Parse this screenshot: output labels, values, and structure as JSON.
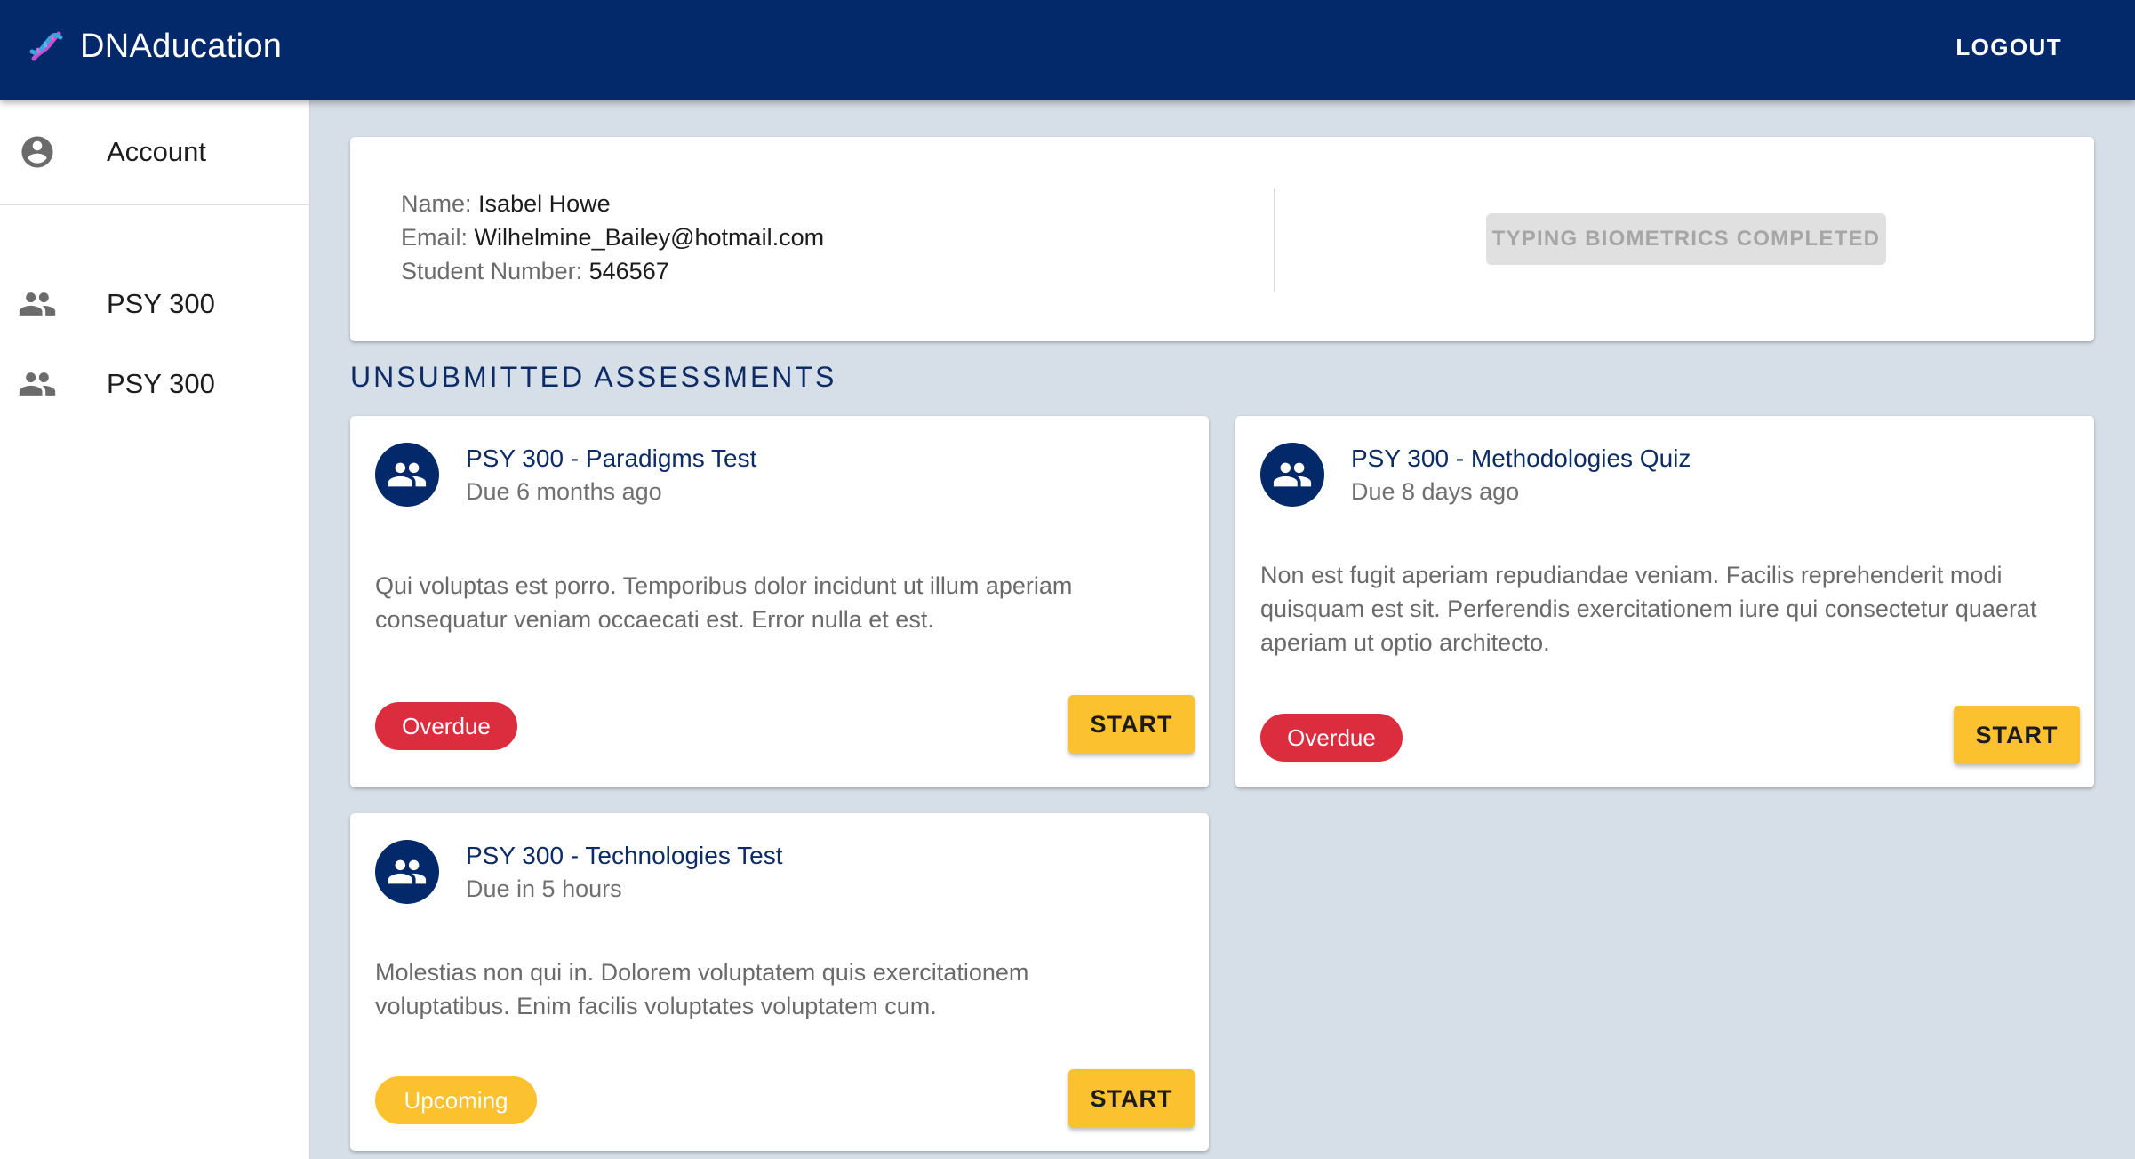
{
  "app": {
    "name": "DNAducation",
    "logout_label": "LOGOUT",
    "colors": {
      "primary": "#03296a",
      "accent": "#fbc12f",
      "danger": "#dc2d3e"
    }
  },
  "sidebar": {
    "items": [
      {
        "label": "Account",
        "icon": "account-circle-icon"
      },
      {
        "label": "PSY 300",
        "icon": "group-icon"
      },
      {
        "label": "PSY 300",
        "icon": "group-icon"
      }
    ]
  },
  "profile": {
    "name_label": "Name:",
    "name": "Isabel Howe",
    "email_label": "Email:",
    "email": "Wilhelmine_Bailey@hotmail.com",
    "student_number_label": "Student Number:",
    "student_number": "546567",
    "biometrics_button": "TYPING BIOMETRICS COMPLETED"
  },
  "assessments": {
    "section_title": "UNSUBMITTED ASSESSMENTS",
    "items": [
      {
        "title": "PSY 300 - Paradigms Test",
        "due": "Due 6 months ago",
        "description_lines": [
          "Qui voluptas est porro. Temporibus dolor incidunt ut illum aperiam",
          "consequatur veniam occaecati est. Error nulla et est."
        ],
        "status": "Overdue",
        "action": "START"
      },
      {
        "title": "PSY 300 - Methodologies Quiz",
        "due": "Due 8 days ago",
        "description_lines": [
          "Non est fugit aperiam repudiandae veniam. Facilis reprehenderit modi",
          "quisquam est sit. Perferendis exercitationem iure qui consectetur quaerat",
          "aperiam ut optio architecto."
        ],
        "status": "Overdue",
        "action": "START"
      },
      {
        "title": "PSY 300 - Technologies Test",
        "due": "Due in 5 hours",
        "description_lines": [
          "Molestias non qui in. Dolorem voluptatem quis exercitationem",
          "voluptatibus. Enim facilis voluptates voluptatem cum."
        ],
        "status": "Upcoming",
        "action": "START"
      }
    ]
  }
}
